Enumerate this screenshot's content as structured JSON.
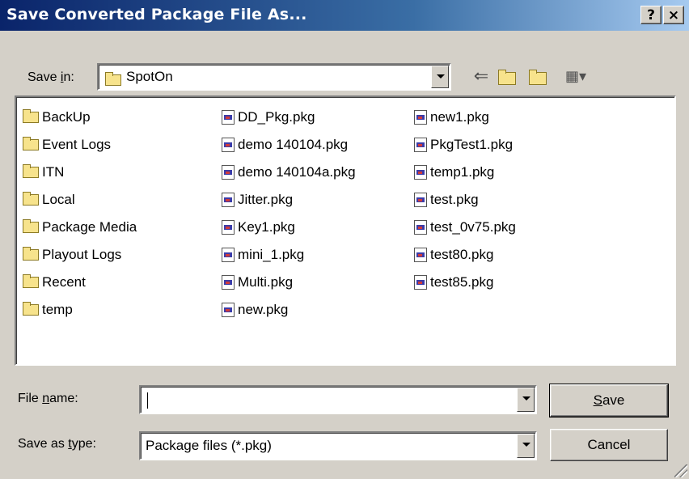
{
  "window": {
    "title": "Save Converted Package File As...",
    "help_label": "?",
    "close_label": "×"
  },
  "save_in": {
    "label_pre": "Save ",
    "label_accel": "i",
    "label_post": "n:",
    "folder": "SpotOn"
  },
  "toolbar": {
    "back_glyph": "⇐",
    "up_glyph": "⬒",
    "new_folder_glyph": "✱",
    "view_glyph": "▦▾"
  },
  "files": {
    "col1": [
      {
        "name": "BackUp",
        "type": "folder"
      },
      {
        "name": "Event Logs",
        "type": "folder"
      },
      {
        "name": "ITN",
        "type": "folder"
      },
      {
        "name": "Local",
        "type": "folder"
      },
      {
        "name": "Package Media",
        "type": "folder"
      },
      {
        "name": "Playout Logs",
        "type": "folder"
      },
      {
        "name": "Recent",
        "type": "folder"
      },
      {
        "name": "temp",
        "type": "folder"
      }
    ],
    "col2": [
      {
        "name": "DD_Pkg.pkg",
        "type": "pkg"
      },
      {
        "name": "demo 140104.pkg",
        "type": "pkg"
      },
      {
        "name": "demo 140104a.pkg",
        "type": "pkg"
      },
      {
        "name": "Jitter.pkg",
        "type": "pkg"
      },
      {
        "name": "Key1.pkg",
        "type": "pkg"
      },
      {
        "name": "mini_1.pkg",
        "type": "pkg"
      },
      {
        "name": "Multi.pkg",
        "type": "pkg"
      },
      {
        "name": "new.pkg",
        "type": "pkg"
      }
    ],
    "col3": [
      {
        "name": "new1.pkg",
        "type": "pkg"
      },
      {
        "name": "PkgTest1.pkg",
        "type": "pkg"
      },
      {
        "name": "temp1.pkg",
        "type": "pkg"
      },
      {
        "name": "test.pkg",
        "type": "pkg"
      },
      {
        "name": "test_0v75.pkg",
        "type": "pkg"
      },
      {
        "name": "test80.pkg",
        "type": "pkg"
      },
      {
        "name": "test85.pkg",
        "type": "pkg"
      }
    ]
  },
  "file_name": {
    "label_pre": "File ",
    "label_accel": "n",
    "label_post": "ame:",
    "value": ""
  },
  "save_as_type": {
    "label_pre": "Save as ",
    "label_accel": "t",
    "label_post": "ype:",
    "value": "Package files (*.pkg)"
  },
  "buttons": {
    "save_accel": "S",
    "save_rest": "ave",
    "cancel": "Cancel"
  }
}
